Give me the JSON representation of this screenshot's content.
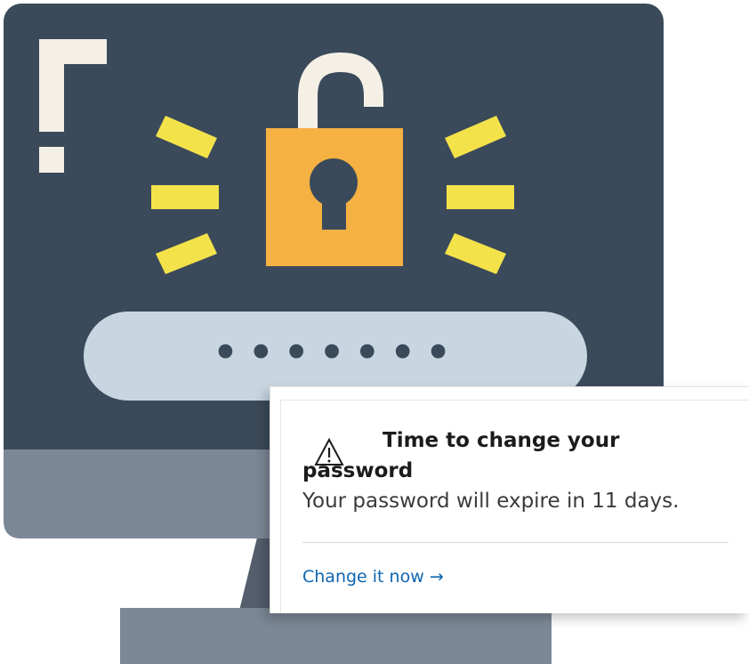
{
  "notification": {
    "icon": "warning-triangle-icon",
    "title": "Time to change your password",
    "message": "Your password will expire in 11 days.",
    "action_label": "Change it now",
    "action_arrow": "→",
    "accent_color": "#0f66b0"
  },
  "illustration": {
    "screen_color": "#3b4a5a",
    "lock_color": "#f6b143",
    "ray_color": "#f4e24b",
    "password_mask": "•••••••",
    "bezel_color": "#7c8896",
    "field_color": "#c8d6e2"
  }
}
